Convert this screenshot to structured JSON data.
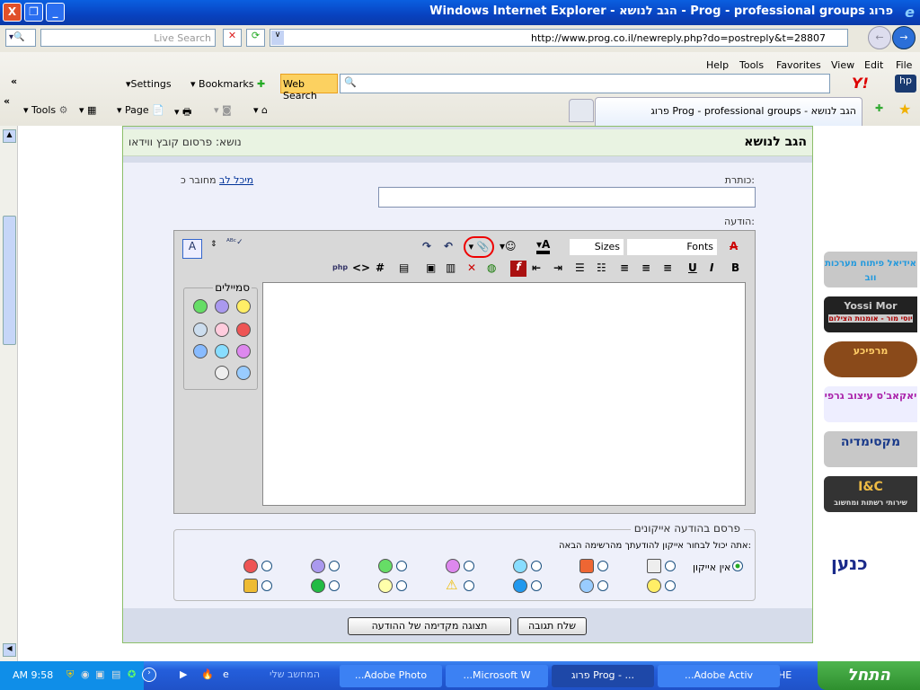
{
  "window": {
    "title": "Windows Internet Explorer - הגב לנושא - Prog - professional groups פרוג"
  },
  "address": {
    "search_placeholder": "Live Search",
    "url": "http://www.prog.co.il/newreply.php?do=postreply&t=28807"
  },
  "menu": [
    "Help",
    "Tools",
    "Favorites",
    "View",
    "Edit",
    "File"
  ],
  "yahoo_toolbar": {
    "settings": "Settings",
    "bookmarks": "Bookmarks",
    "web_search": "Web Search",
    "collapse": "«"
  },
  "command_bar": {
    "tools": "Tools",
    "page": "Page",
    "collapse": "«"
  },
  "tab": {
    "label": "פרוג Prog - professional groups - הגב לנושא"
  },
  "page": {
    "header_title": "הגב לנושא",
    "topic_label": "נושא:",
    "topic_value": "פרסום קובץ ווידאו",
    "title_label": "כותרת:",
    "logged_in_prefix": "מחובר כ",
    "username": "מיכל לב",
    "message_label": "הודעה:",
    "editor": {
      "fonts": "Fonts",
      "sizes": "Sizes",
      "smilies_title": "סמיילים"
    },
    "icons_section": {
      "legend": "פרסם בהודעה אייקונים",
      "hint": "אתה יכול לבחור אייקון להודעתך מהרשימה הבאה:",
      "no_icon": "אין אייקון"
    },
    "submit": "שלח תגובה",
    "preview": "תצוגה מקדימה של ההודעה"
  },
  "ads": [
    "אידיאל פיתוח מערכות ווב",
    "Yossi Mor",
    "יוסי מור - אומנות הצילום",
    "מרפיכע",
    "יאקאב'ס עיצוב גרפי",
    "מקסימדיה",
    "I&C",
    "שירותי רשתות ומחשוב",
    "כנען"
  ],
  "taskbar": {
    "start": "התחל",
    "lang": "HE",
    "tasks": [
      "...Adobe Activ",
      "פרוג Prog - ...",
      "...Microsoft W",
      "...Adobe Photo"
    ],
    "quicklaunch": "המחשב שלי",
    "clock": "AM 9:58"
  }
}
